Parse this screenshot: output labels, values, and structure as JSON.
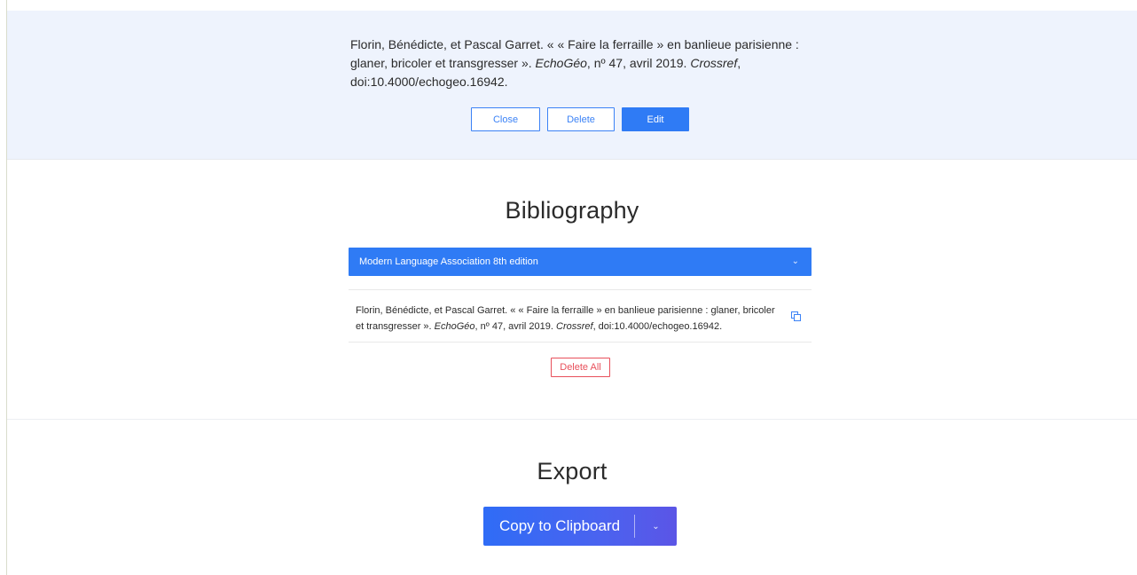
{
  "preview": {
    "citation_part1": "Florin, Bénédicte, et Pascal Garret. « « Faire la ferraille » en banlieue parisienne : glaner, bricoler et transgresser ». ",
    "journal": "EchoGéo",
    "citation_part2": ", nº 47, avril 2019. ",
    "source": "Crossref",
    "citation_part3": ", doi:10.4000/echogeo.16942.",
    "close_label": "Close",
    "delete_label": "Delete",
    "edit_label": "Edit"
  },
  "bibliography": {
    "title": "Bibliography",
    "style_selected": "Modern Language Association 8th edition",
    "chevron_icon": "chevron-down-icon",
    "entries": [
      {
        "text_part1": "Florin, Bénédicte, et Pascal Garret. « « Faire la ferraille » en banlieue parisienne : glaner, bricoler et transgresser ». ",
        "journal": "EchoGéo",
        "text_part2": ", nº 47, avril 2019. ",
        "source": "Crossref",
        "text_part3": ", doi:10.4000/echogeo.16942.",
        "copy_icon": "copy-icon"
      }
    ],
    "delete_all_label": "Delete All"
  },
  "export": {
    "title": "Export",
    "copy_label": "Copy to Clipboard",
    "dropdown_icon": "chevron-down-icon"
  },
  "colors": {
    "accent": "#2f7bf5",
    "danger": "#e8505b",
    "preview_bg": "#eef3fd"
  }
}
